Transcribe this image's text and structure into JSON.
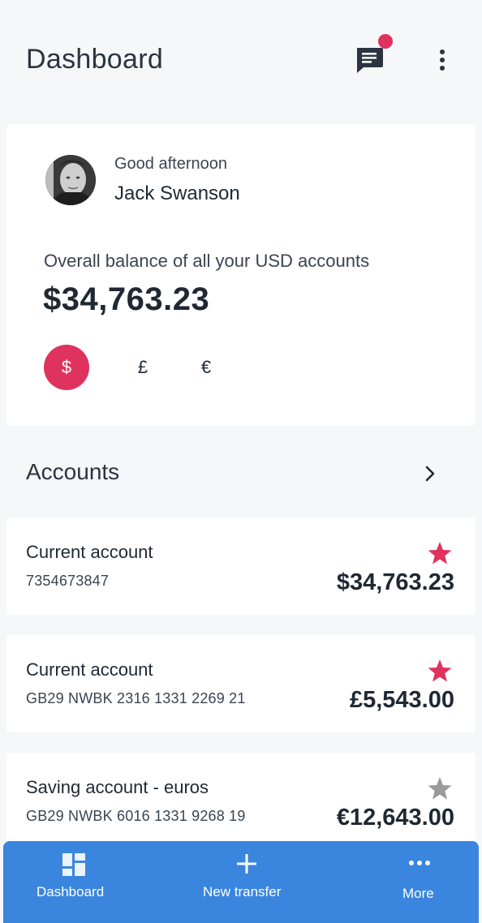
{
  "header": {
    "title": "Dashboard",
    "messages_icon": "chat-message-icon",
    "notification_color": "#e0325e",
    "more_icon": "more-vertical-icon"
  },
  "summary": {
    "greeting": "Good afternoon",
    "user_name": "Jack Swanson",
    "balance_label": "Overall balance of all your USD accounts",
    "balance": "$34,763.23",
    "currencies": [
      {
        "symbol": "$",
        "selected": true
      },
      {
        "symbol": "£",
        "selected": false
      },
      {
        "symbol": "€",
        "selected": false
      }
    ]
  },
  "accounts": {
    "title": "Accounts",
    "items": [
      {
        "name": "Current account",
        "number": "7354673847",
        "amount": "$34,763.23",
        "favorite": true
      },
      {
        "name": "Current account",
        "number": "GB29 NWBK 2316 1331 2269 21",
        "amount": "£5,543.00",
        "favorite": true
      },
      {
        "name": "Saving account - euros",
        "number": "GB29 NWBK 6016 1331 9268 19",
        "amount": "€12,643.00",
        "favorite": false
      }
    ]
  },
  "nav": {
    "items": [
      {
        "label": "Dashboard",
        "icon": "dashboard-grid-icon"
      },
      {
        "label": "New transfer",
        "icon": "plus-icon"
      },
      {
        "label": "More",
        "icon": "more-horizontal-icon"
      }
    ]
  },
  "colors": {
    "accent": "#e0325e",
    "nav_background": "#3a86df",
    "star_inactive": "#9a9a9a"
  }
}
